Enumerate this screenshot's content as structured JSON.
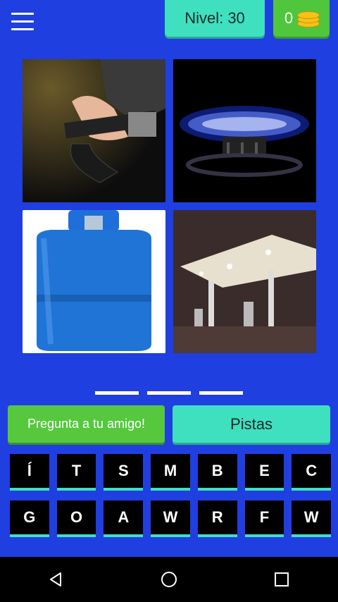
{
  "header": {
    "level_text": "Nivel: 30",
    "coins": "0",
    "icons": {
      "menu": "hamburger-menu-icon",
      "coins": "coin-stack-icon"
    }
  },
  "images": [
    {
      "name": "fuel-nozzle-image"
    },
    {
      "name": "gas-burner-flame-image"
    },
    {
      "name": "blue-gas-cylinder-image"
    },
    {
      "name": "gas-station-image"
    }
  ],
  "answer_slot_count": 3,
  "buttons": {
    "ask_friend": "Pregunta a tu amigo!",
    "hints": "Pistas"
  },
  "keyboard": {
    "row1": [
      "Í",
      "T",
      "S",
      "M",
      "B",
      "E",
      "C"
    ],
    "row2": [
      "G",
      "O",
      "A",
      "W",
      "R",
      "F",
      "W"
    ]
  },
  "colors": {
    "background": "#1f3fe0",
    "accent_teal": "#3fe0c0",
    "accent_green": "#55c83d",
    "key_bg": "#000000"
  },
  "navbar": {
    "icons": [
      "back-icon",
      "home-icon",
      "recents-icon"
    ]
  }
}
